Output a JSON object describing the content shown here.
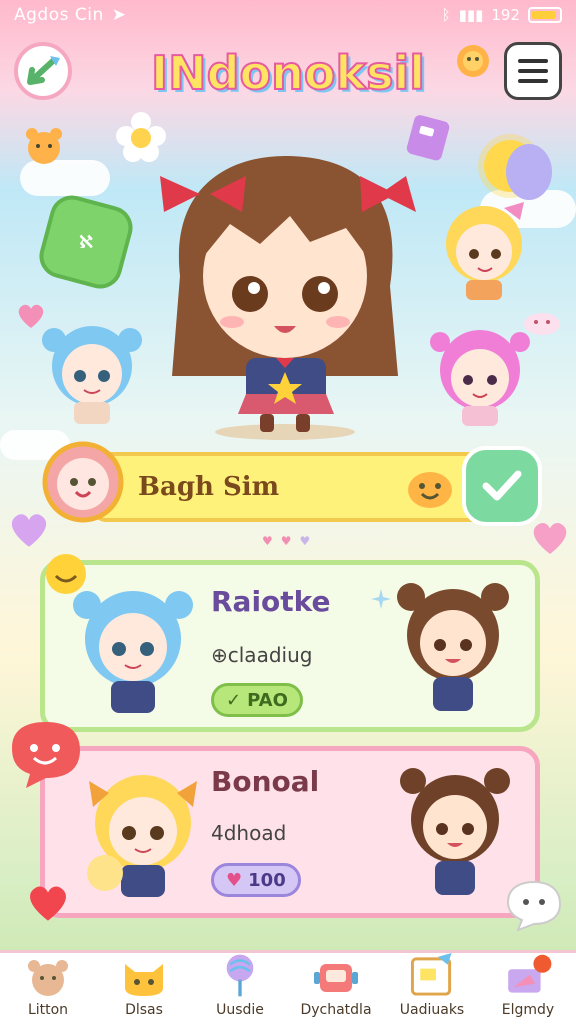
{
  "status_bar": {
    "carrier": "Agdos Cin",
    "right_text": "192"
  },
  "header": {
    "app_title": "INdonoksil"
  },
  "hero": {
    "badge_text": "ℵ"
  },
  "featured": {
    "title": "Bagh Sim"
  },
  "cards": [
    {
      "title": "Raiotke",
      "subtitle": "⊕claadiug",
      "pill": "PAO"
    },
    {
      "title": "Bonoal",
      "subtitle": "4dhoad",
      "pill": "100"
    }
  ],
  "tabs": [
    {
      "label": "Litton"
    },
    {
      "label": "Dlsas"
    },
    {
      "label": "Uusdie"
    },
    {
      "label": "Dychatdla"
    },
    {
      "label": "Uadiuaks"
    },
    {
      "label": "Elgmdy"
    }
  ],
  "colors": {
    "accent": "#f7a6c0",
    "brand": "#ffe463",
    "success": "#7cd9a0"
  }
}
